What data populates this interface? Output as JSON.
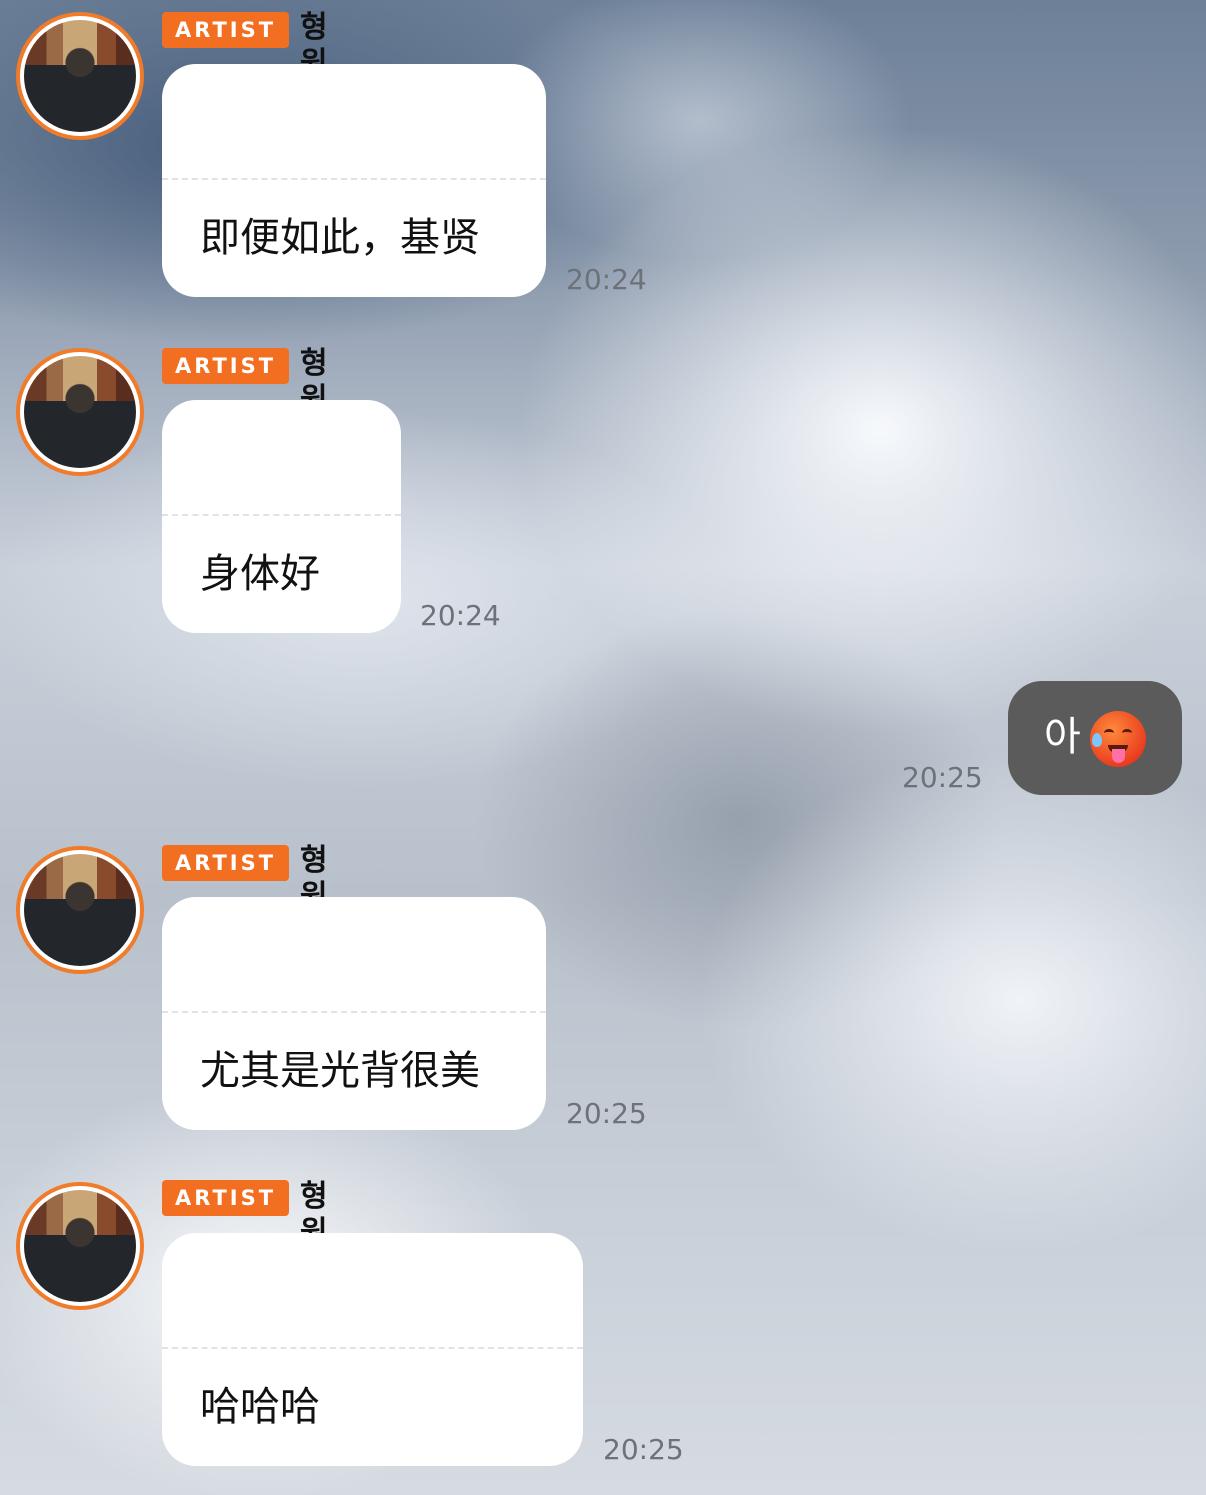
{
  "messages": [
    {
      "badge": "ARTIST",
      "sender": "형원",
      "text": "即便如此，基贤",
      "time": "20:24"
    },
    {
      "badge": "ARTIST",
      "sender": "형원",
      "text": "身体好",
      "time": "20:24"
    },
    {
      "badge": "ARTIST",
      "sender": "형원",
      "text": "尤其是光背很美",
      "time": "20:25"
    },
    {
      "badge": "ARTIST",
      "sender": "형원",
      "text": "哈哈哈",
      "time": "20:25"
    }
  ],
  "my_message": {
    "text": "아",
    "emoji": "hot-face-emoji",
    "time": "20:25"
  },
  "colors": {
    "badge": "#f26f21",
    "avatar_ring": "#f07b2a",
    "my_bubble": "#5b5b5b"
  }
}
